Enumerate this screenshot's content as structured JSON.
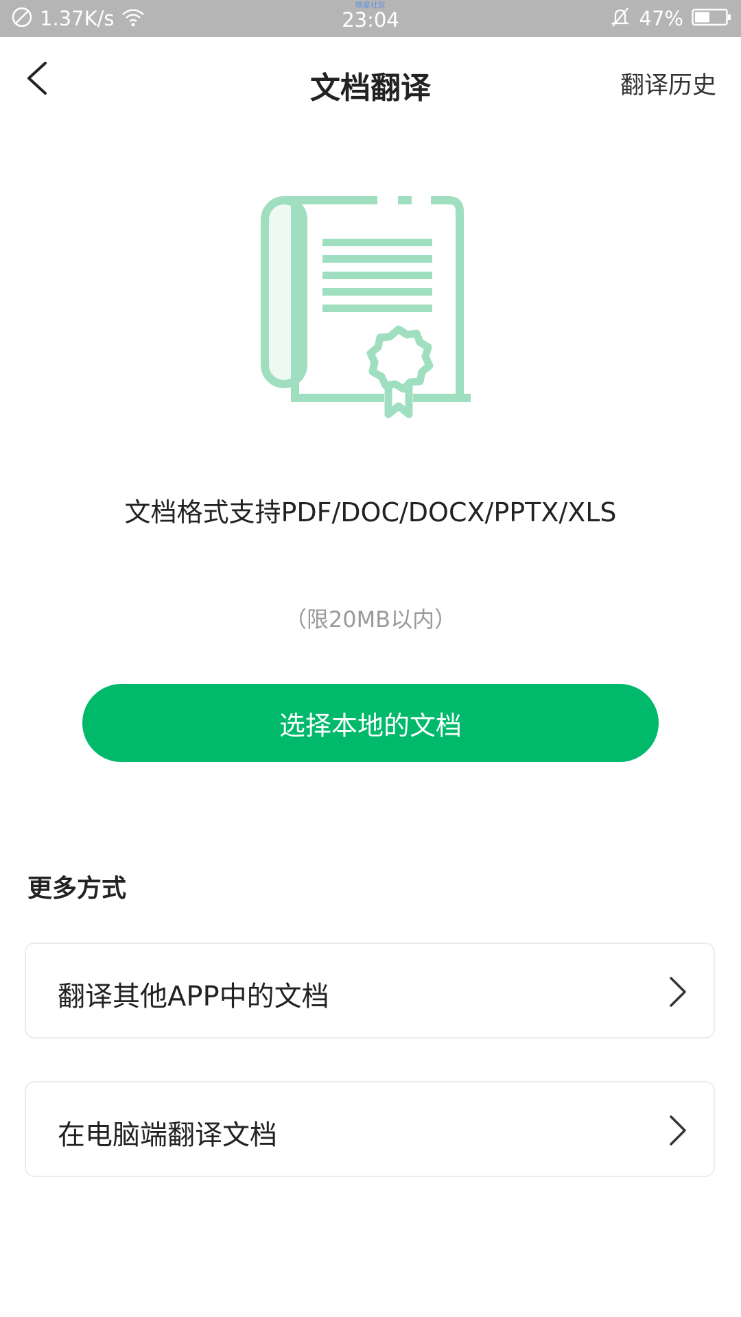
{
  "status_bar": {
    "network_speed": "1.37K/s",
    "watermark": "喷星社区",
    "time": "23:04",
    "battery": "47%",
    "icons": [
      "no-sim-icon",
      "wifi-icon",
      "bell-muted-icon",
      "battery-icon"
    ]
  },
  "header": {
    "title": "文档翻译",
    "history_label": "翻译历史",
    "back_icon": "chevron-left-icon"
  },
  "main": {
    "illustration_icon": "document-certificate-icon",
    "formats_text": "文档格式支持PDF/DOC/DOCX/PPTX/XLS",
    "size_limit": "（限20MB以内）",
    "select_button": "选择本地的文档"
  },
  "more": {
    "title": "更多方式",
    "options": [
      {
        "label": "翻译其他APP中的文档"
      },
      {
        "label": "在电脑端翻译文档"
      }
    ]
  },
  "colors": {
    "accent": "#00b96b",
    "illustration": "#9fdfc0",
    "status_bar": "#b5b5b5"
  }
}
